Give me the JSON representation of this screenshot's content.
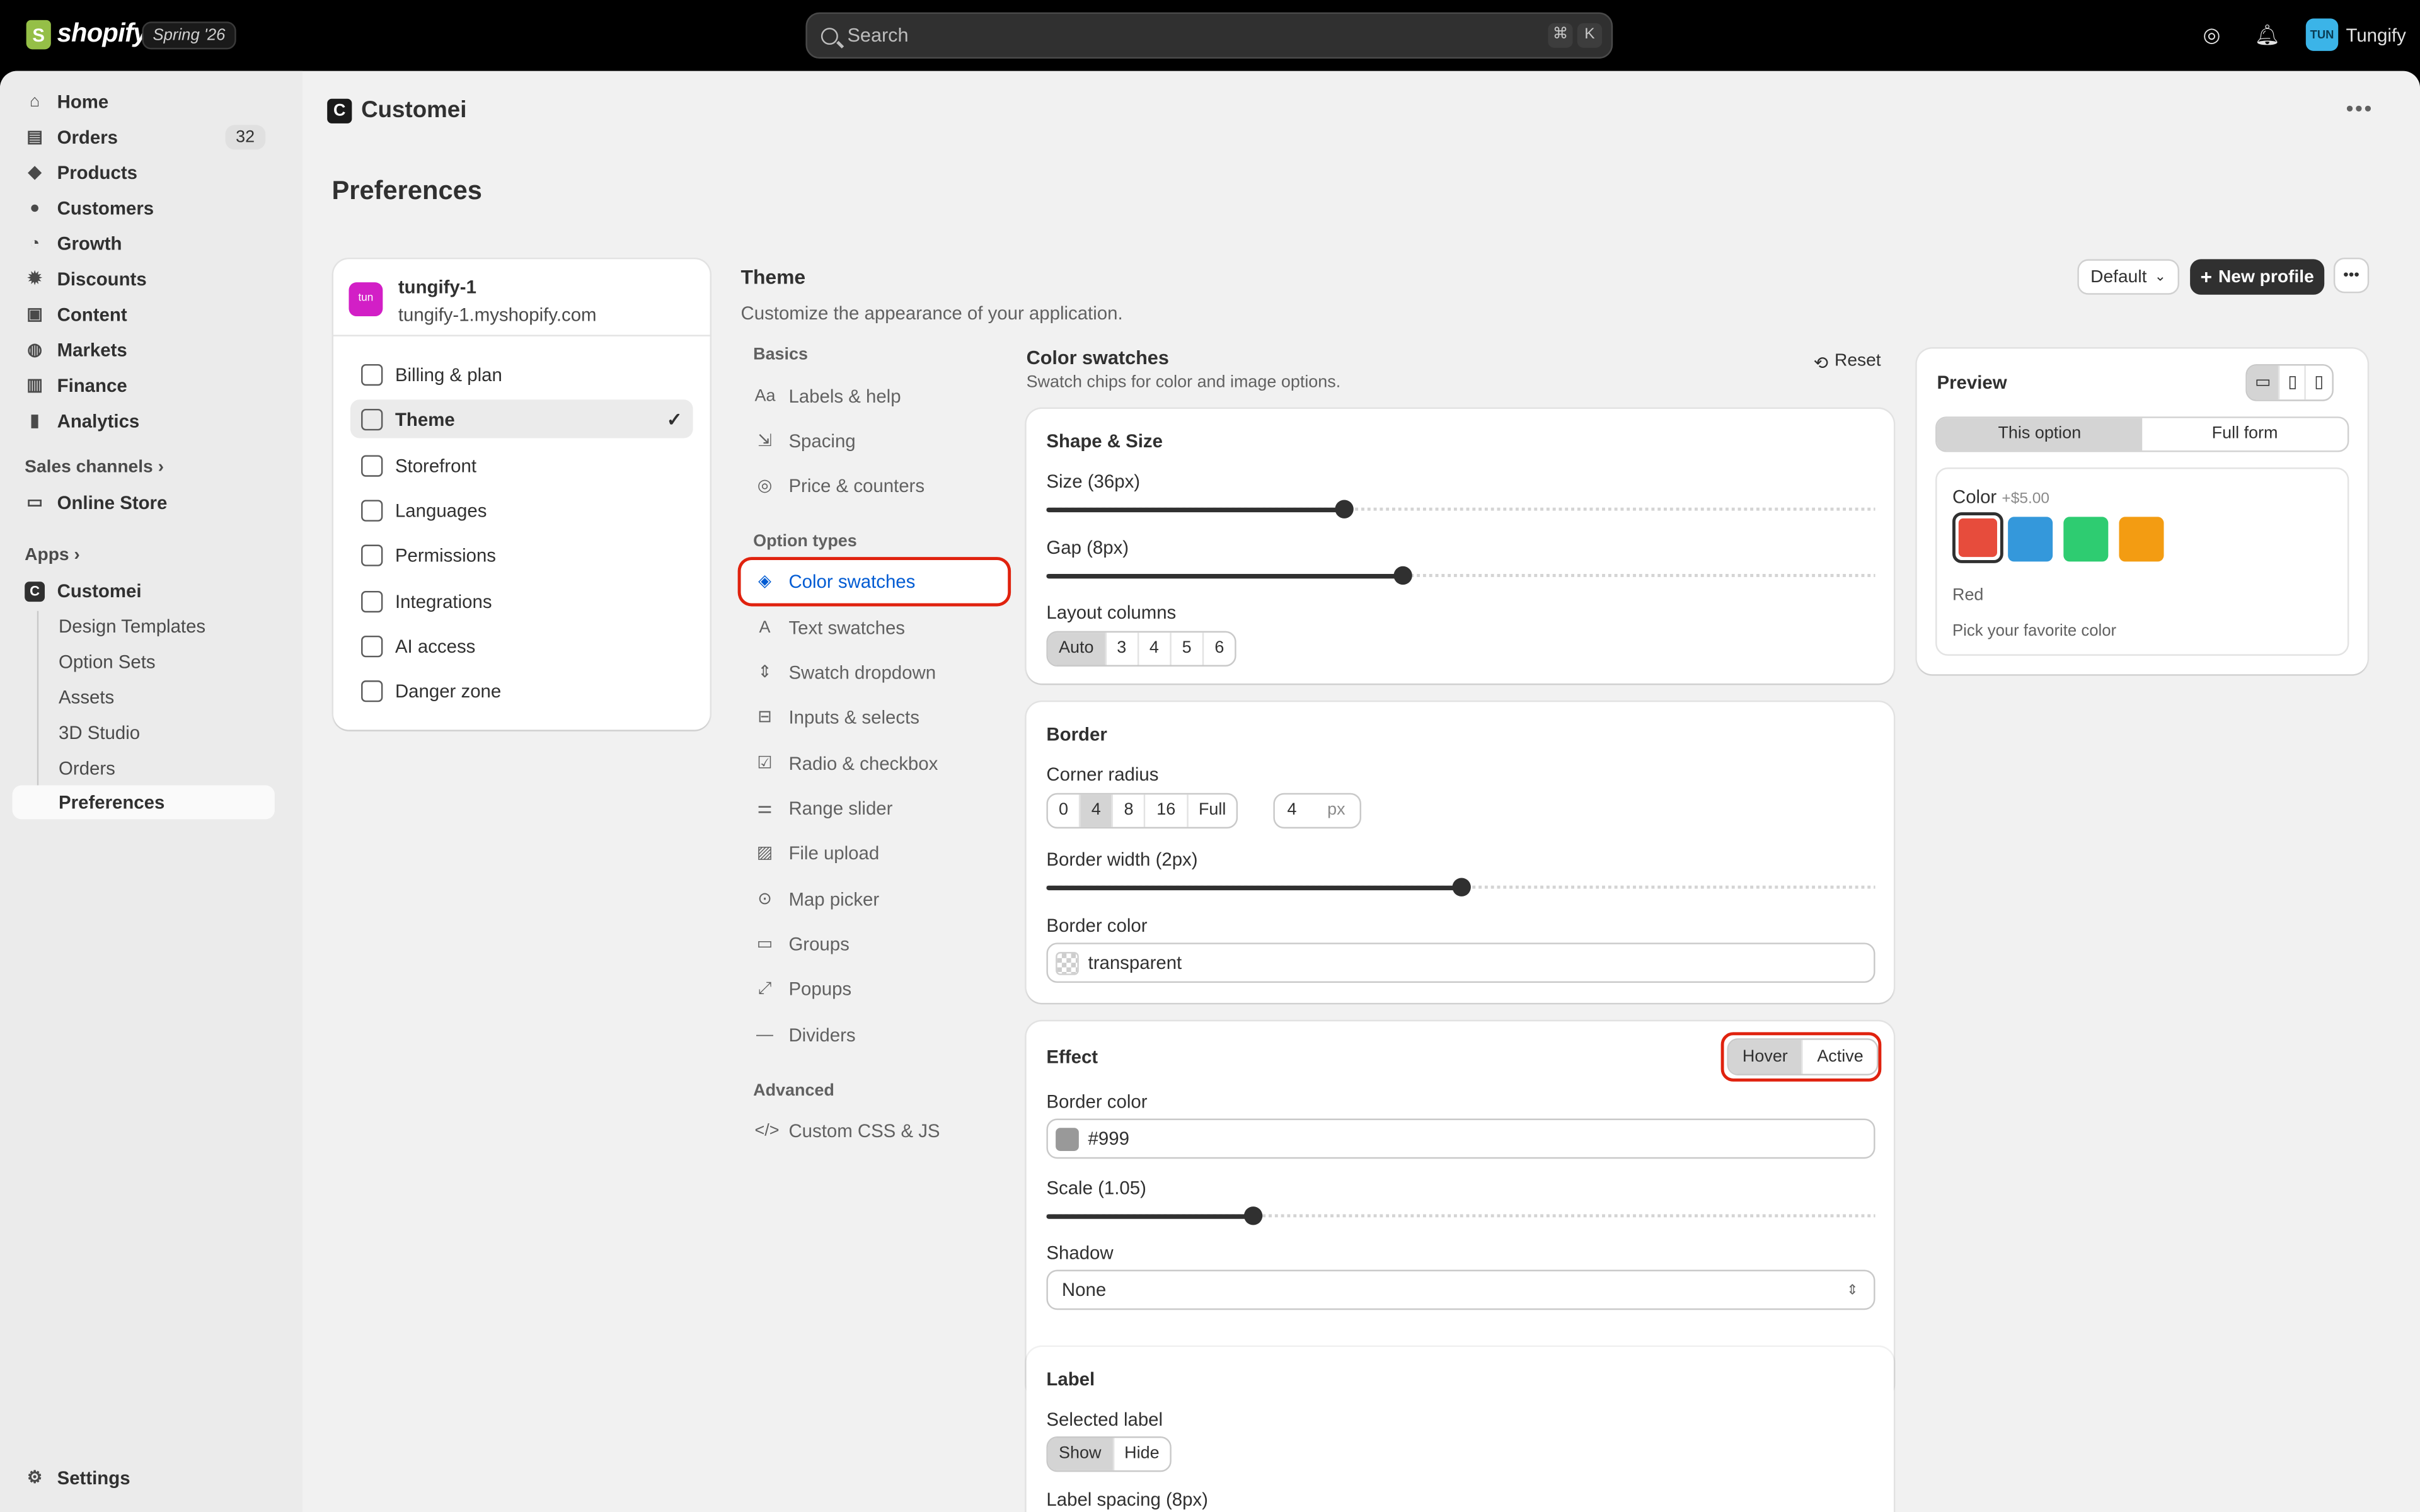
{
  "topbar": {
    "brand": "shopify",
    "edition": "Spring '26",
    "search_placeholder": "Search",
    "kbd1": "⌘",
    "kbd2": "K",
    "user_initials": "TUN",
    "user_name": "Tungify"
  },
  "sidebar": {
    "items": [
      {
        "label": "Home",
        "icon": "home-icon"
      },
      {
        "label": "Orders",
        "icon": "orders-icon",
        "badge": "32"
      },
      {
        "label": "Products",
        "icon": "tag-icon"
      },
      {
        "label": "Customers",
        "icon": "person-icon"
      },
      {
        "label": "Growth",
        "icon": "growth-icon"
      },
      {
        "label": "Discounts",
        "icon": "discount-icon"
      },
      {
        "label": "Content",
        "icon": "content-icon"
      },
      {
        "label": "Markets",
        "icon": "globe-icon"
      },
      {
        "label": "Finance",
        "icon": "bank-icon"
      },
      {
        "label": "Analytics",
        "icon": "chart-icon"
      }
    ],
    "sales_channels": "Sales channels",
    "online_store": "Online Store",
    "apps": "Apps",
    "app_name": "Customei",
    "app_items": [
      "Design Templates",
      "Option Sets",
      "Assets",
      "3D Studio",
      "Orders",
      "Preferences"
    ],
    "settings": "Settings"
  },
  "app": {
    "title": "Customei",
    "page_title": "Preferences"
  },
  "shop": {
    "avatar": "tun",
    "name": "tungify-1",
    "domain": "tungify-1.myshopify.com"
  },
  "settings_menu": [
    "Billing & plan",
    "Theme",
    "Storefront",
    "Languages",
    "Permissions",
    "Integrations",
    "AI access",
    "Danger zone"
  ],
  "theme": {
    "title": "Theme",
    "subtitle": "Customize the appearance of your application.",
    "profile_select": "Default",
    "new_profile": "New profile"
  },
  "option_nav": {
    "basics_title": "Basics",
    "basics": [
      "Labels & help",
      "Spacing",
      "Price & counters"
    ],
    "types_title": "Option types",
    "types": [
      "Color swatches",
      "Text swatches",
      "Swatch dropdown",
      "Inputs & selects",
      "Radio & checkbox",
      "Range slider",
      "File upload",
      "Map picker",
      "Groups",
      "Popups",
      "Dividers"
    ],
    "advanced_title": "Advanced",
    "advanced": [
      "Custom CSS & JS"
    ]
  },
  "editor": {
    "title": "Color swatches",
    "subtitle": "Swatch chips for color and image options.",
    "reset": "Reset",
    "shape": {
      "title": "Shape & Size",
      "size_label": "Size (36px)",
      "size_value": 0.36,
      "gap_label": "Gap (8px)",
      "gap_value": 0.43,
      "columns_label": "Layout columns",
      "columns": [
        "Auto",
        "3",
        "4",
        "5",
        "6"
      ],
      "columns_selected": "Auto"
    },
    "border": {
      "title": "Border",
      "radius_label": "Corner radius",
      "radius_options": [
        "0",
        "4",
        "8",
        "16",
        "Full"
      ],
      "radius_selected": "4",
      "radius_value": "4",
      "radius_unit": "px",
      "width_label": "Border width (2px)",
      "width_value": 0.5,
      "color_label": "Border color",
      "color_value": "transparent"
    },
    "effect": {
      "title": "Effect",
      "tabs": [
        "Hover",
        "Active"
      ],
      "tab_selected": "Hover",
      "border_color_label": "Border color",
      "border_color_value": "#999",
      "scale_label": "Scale (1.05)",
      "scale_value": 0.25,
      "shadow_label": "Shadow",
      "shadow_value": "None"
    },
    "label": {
      "title": "Label",
      "selected_label": "Selected label",
      "options": [
        "Show",
        "Hide"
      ],
      "selected": "Show",
      "spacing_label": "Label spacing (8px)"
    }
  },
  "preview": {
    "title": "Preview",
    "tabs": [
      "This option",
      "Full form"
    ],
    "tab_selected": "This option",
    "option_label": "Color",
    "price": "+$5.00",
    "swatches": [
      "#e74c3c",
      "#3498db",
      "#2ecc71",
      "#f39c12"
    ],
    "selected_name": "Red",
    "help": "Pick your favorite color"
  }
}
